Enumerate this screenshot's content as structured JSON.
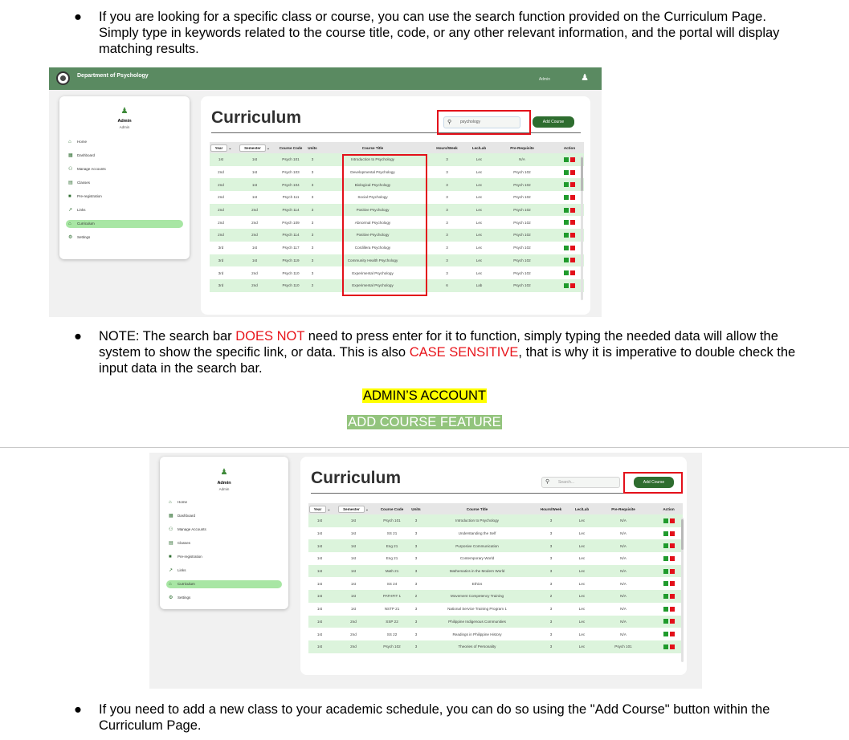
{
  "bullet1": {
    "marker": "●",
    "text": "If you are looking for a specific class or course, you can use the search function provided on the Curriculum Page. Simply type in keywords related to the course title, code, or any other relevant information, and the portal will display matching results."
  },
  "bullet2": {
    "marker": "●",
    "prefix": "NOTE: The search bar ",
    "red1": "DOES NOT",
    "middle": " need to press enter for it to function, simply typing the needed data will allow the system to show the specific link, or data. This is also ",
    "red2": "CASE SENSITIVE",
    "suffix": ", that is why it is imperative to double check the input data in the search bar."
  },
  "heading_admin": "ADMIN’S ACCOUNT",
  "heading_feature": "ADD COURSE FEATURE",
  "bullet3": {
    "marker": "●",
    "text": "If you need to add a new class to your academic schedule, you can do so using the \"Add Course\" button within the Curriculum Page."
  },
  "colors": {
    "topbar": "#5a8a61",
    "accent_green": "#2e6d2f",
    "row_green": "#dcf4dc",
    "highlight_box": "#e3101a"
  },
  "screenshot1": {
    "header": {
      "dept_name": "Department of Psychology",
      "admin_label": "Admin",
      "user_icon": "user-icon",
      "logo": "department-seal"
    },
    "sidebar": {
      "name": "Admin",
      "role": "Admin",
      "items": [
        {
          "label": "Home",
          "icon": "home-icon"
        },
        {
          "label": "Dashboard",
          "icon": "dashboard-icon"
        },
        {
          "label": "Manage Accounts",
          "icon": "accounts-icon"
        },
        {
          "label": "Classes",
          "icon": "classes-icon"
        },
        {
          "label": "Pre-registration",
          "icon": "document-icon"
        },
        {
          "label": "Links",
          "icon": "link-icon"
        },
        {
          "label": "Curriculum",
          "icon": "curriculum-icon",
          "active": true
        },
        {
          "label": "Settings",
          "icon": "gear-icon"
        }
      ]
    },
    "title": "Curriculum",
    "search_value": "psychology",
    "add_button": "Add Course",
    "columns": [
      "Year",
      "Semester",
      "Course Code",
      "Units",
      "Course Title",
      "Hours/Week",
      "Lec/Lab",
      "Pre-Requisite",
      "Action"
    ],
    "rows": [
      [
        "1st",
        "1st",
        "Psych 101",
        "3",
        "Introduction to Psychology",
        "3",
        "Lec",
        "N/A"
      ],
      [
        "2nd",
        "1st",
        "Psych 103",
        "3",
        "Developmental Psychology",
        "3",
        "Lec",
        "Psych 102"
      ],
      [
        "2nd",
        "1st",
        "Psych 104",
        "3",
        "Biological Psychology",
        "3",
        "Lec",
        "Psych 102"
      ],
      [
        "2nd",
        "1st",
        "Psych 111",
        "3",
        "Social Psychology",
        "3",
        "Lec",
        "Psych 102"
      ],
      [
        "2nd",
        "2nd",
        "Psych 114",
        "3",
        "Positive Psychology",
        "3",
        "Lec",
        "Psych 102"
      ],
      [
        "2nd",
        "2nd",
        "Psych 109",
        "3",
        "Abnormal Psychology",
        "3",
        "Lec",
        "Psych 102"
      ],
      [
        "2nd",
        "2nd",
        "Psych 114",
        "3",
        "Positive Psychology",
        "3",
        "Lec",
        "Psych 102"
      ],
      [
        "3rd",
        "1st",
        "Psych 117",
        "3",
        "Cordillera Psychology",
        "3",
        "Lec",
        "Psych 102"
      ],
      [
        "3rd",
        "1st",
        "Psych 119",
        "3",
        "Community Health Psychology",
        "3",
        "Lec",
        "Psych 102"
      ],
      [
        "3rd",
        "2nd",
        "Psych 110",
        "3",
        "Experimental Psychology",
        "3",
        "Lec",
        "Psych 102"
      ],
      [
        "3rd",
        "2nd",
        "Psych 110",
        "2",
        "Experimental Psychology",
        "6",
        "Lab",
        "Psych 102"
      ]
    ]
  },
  "screenshot2": {
    "sidebar": {
      "name": "Admin",
      "role": "Admin",
      "items": [
        {
          "label": "Home",
          "icon": "home-icon"
        },
        {
          "label": "Dashboard",
          "icon": "dashboard-icon"
        },
        {
          "label": "Manage Accounts",
          "icon": "accounts-icon"
        },
        {
          "label": "Classes",
          "icon": "classes-icon"
        },
        {
          "label": "Pre-registration",
          "icon": "document-icon"
        },
        {
          "label": "Links",
          "icon": "link-icon"
        },
        {
          "label": "Curriculum",
          "icon": "curriculum-icon",
          "active": true
        },
        {
          "label": "Settings",
          "icon": "gear-icon"
        }
      ]
    },
    "title": "Curriculum",
    "search_placeholder": "Search...",
    "add_button": "Add Course",
    "columns": [
      "Year",
      "Semester",
      "Course Code",
      "Units",
      "Course Title",
      "Hours/Week",
      "Lec/Lab",
      "Pre-Requisite",
      "Action"
    ],
    "rows": [
      [
        "1st",
        "1st",
        "Psych 101",
        "3",
        "Introduction to Psychology",
        "3",
        "Lec",
        "N/A"
      ],
      [
        "1st",
        "1st",
        "SS 21",
        "3",
        "Understanding the Self",
        "3",
        "Lec",
        "N/A"
      ],
      [
        "1st",
        "1st",
        "Eng 21",
        "3",
        "Purposive Communication",
        "3",
        "Lec",
        "N/A"
      ],
      [
        "1st",
        "1st",
        "Eng 21",
        "3",
        "Contemporary World",
        "3",
        "Lec",
        "N/A"
      ],
      [
        "1st",
        "1st",
        "Math 21",
        "3",
        "Mathematics in the Modern World",
        "3",
        "Lec",
        "N/A"
      ],
      [
        "1st",
        "1st",
        "SS 24",
        "3",
        "Ethics",
        "3",
        "Lec",
        "N/A"
      ],
      [
        "1st",
        "1st",
        "PATHFIT 1",
        "2",
        "Movement Competency Training",
        "2",
        "Lec",
        "N/A"
      ],
      [
        "1st",
        "1st",
        "NSTP 21",
        "3",
        "National Service Training Program 1",
        "3",
        "Lec",
        "N/A"
      ],
      [
        "1st",
        "2nd",
        "SSP 22",
        "3",
        "Philippine Indigenous Communities",
        "3",
        "Lec",
        "N/A"
      ],
      [
        "1st",
        "2nd",
        "SS 22",
        "3",
        "Readings in Philippine History",
        "3",
        "Lec",
        "N/A"
      ],
      [
        "1st",
        "2nd",
        "Psych 102",
        "3",
        "Theories of Personality",
        "3",
        "Lec",
        "Psych 101"
      ]
    ]
  }
}
